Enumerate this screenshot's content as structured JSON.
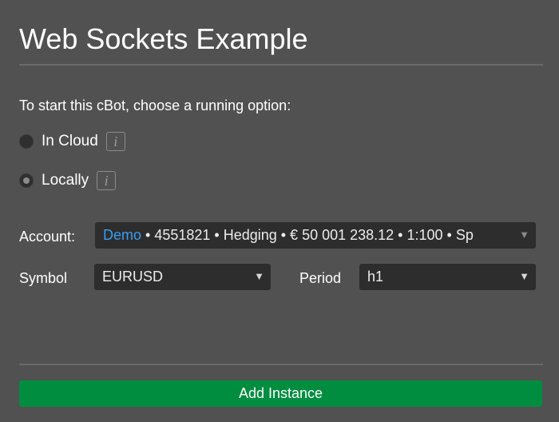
{
  "page": {
    "title": "Web Sockets Example"
  },
  "run_options": {
    "prompt": "To start this cBot, choose a running option:",
    "options": [
      {
        "label": "In Cloud",
        "selected": false,
        "info_icon": "info-icon"
      },
      {
        "label": "Locally",
        "selected": true,
        "info_icon": "info-icon"
      }
    ]
  },
  "form": {
    "account_label": "Account:",
    "account": {
      "type": "Demo",
      "details": " • 4551821 • Hedging • € 50 001 238.12 • 1:100  •  Sp"
    },
    "symbol_label": "Symbol",
    "symbol_value": "EURUSD",
    "period_label": "Period",
    "period_value": "h1"
  },
  "actions": {
    "add_instance_label": "Add Instance"
  },
  "colors": {
    "background": "#515151",
    "accent_button": "#008d3f",
    "demo_link": "#3a9bf0",
    "select_bg": "#2d2d2d"
  }
}
